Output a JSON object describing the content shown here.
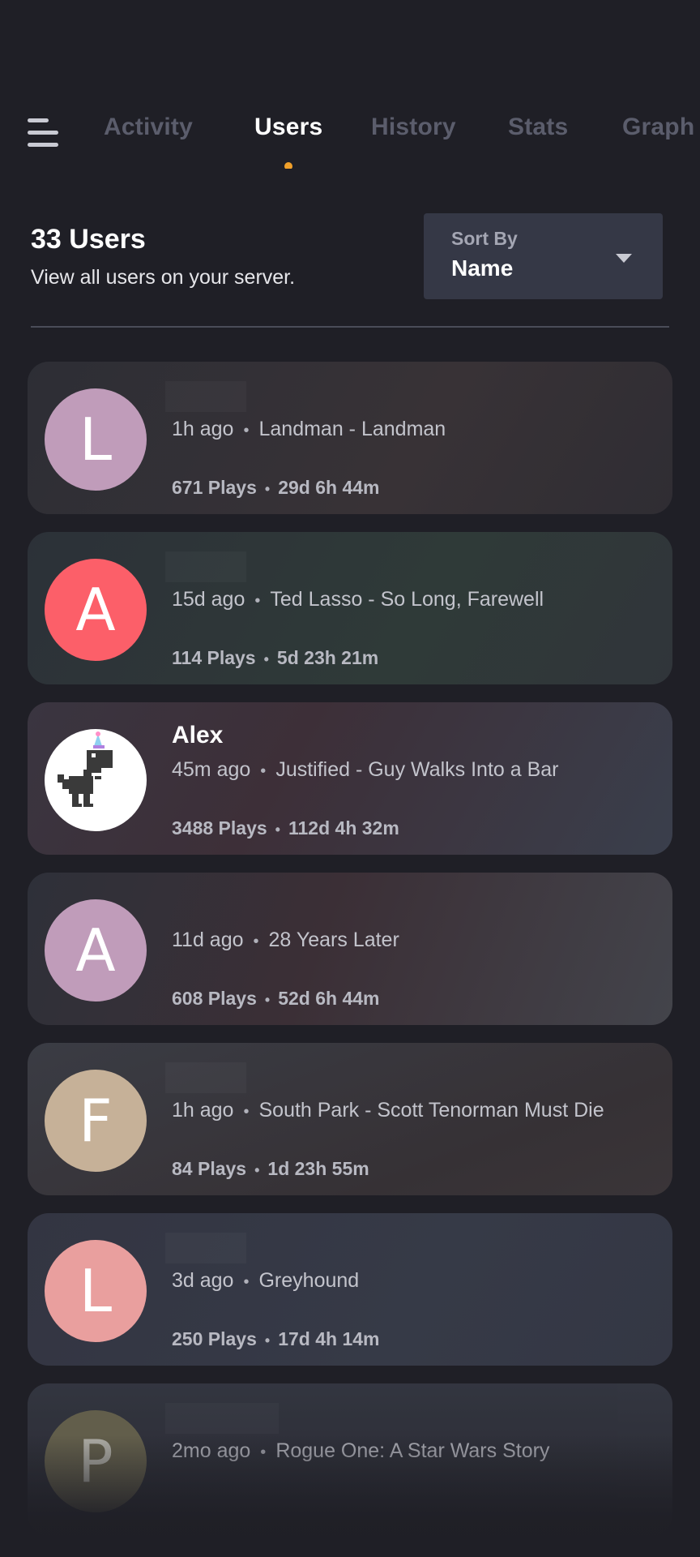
{
  "nav": {
    "tabs": [
      {
        "label": "Activity",
        "active": false
      },
      {
        "label": "Users",
        "active": true
      },
      {
        "label": "History",
        "active": false
      },
      {
        "label": "Stats",
        "active": false
      },
      {
        "label": "Graph",
        "active": false
      }
    ],
    "active_indicator_color": "#f0a02a"
  },
  "header": {
    "title": "33 Users",
    "subtitle": "View all users on your server."
  },
  "sort": {
    "label": "Sort By",
    "value": "Name"
  },
  "users": [
    {
      "name": "",
      "avatar_letter": "L",
      "avatar_color": "#c09cba",
      "last_seen": "1h ago",
      "last_played": "Landman - Landman",
      "plays": "671 Plays",
      "duration": "29d 6h 44m"
    },
    {
      "name": "",
      "avatar_letter": "A",
      "avatar_color": "#fc5f69",
      "last_seen": "15d ago",
      "last_played": "Ted Lasso - So Long, Farewell",
      "plays": "114 Plays",
      "duration": "5d 23h 21m"
    },
    {
      "name": "Alex",
      "avatar_letter": "",
      "avatar_color": "#ffffff",
      "last_seen": "45m ago",
      "last_played": "Justified - Guy Walks Into a Bar",
      "plays": "3488 Plays",
      "duration": "112d 4h 32m"
    },
    {
      "name": "",
      "avatar_letter": "A",
      "avatar_color": "#c09cba",
      "last_seen": "11d ago",
      "last_played": "28 Years Later",
      "plays": "608 Plays",
      "duration": "52d 6h 44m"
    },
    {
      "name": "",
      "avatar_letter": "F",
      "avatar_color": "#c6b198",
      "last_seen": "1h ago",
      "last_played": "South Park - Scott Tenorman Must Die",
      "plays": "84 Plays",
      "duration": "1d 23h 55m"
    },
    {
      "name": "",
      "avatar_letter": "L",
      "avatar_color": "#e99f9e",
      "last_seen": "3d ago",
      "last_played": "Greyhound",
      "plays": "250 Plays",
      "duration": "17d 4h 14m"
    },
    {
      "name": "",
      "avatar_letter": "P",
      "avatar_color": "#6e6a52",
      "last_seen": "2mo ago",
      "last_played": "Rogue One: A Star Wars Story",
      "plays": "",
      "duration": ""
    }
  ]
}
